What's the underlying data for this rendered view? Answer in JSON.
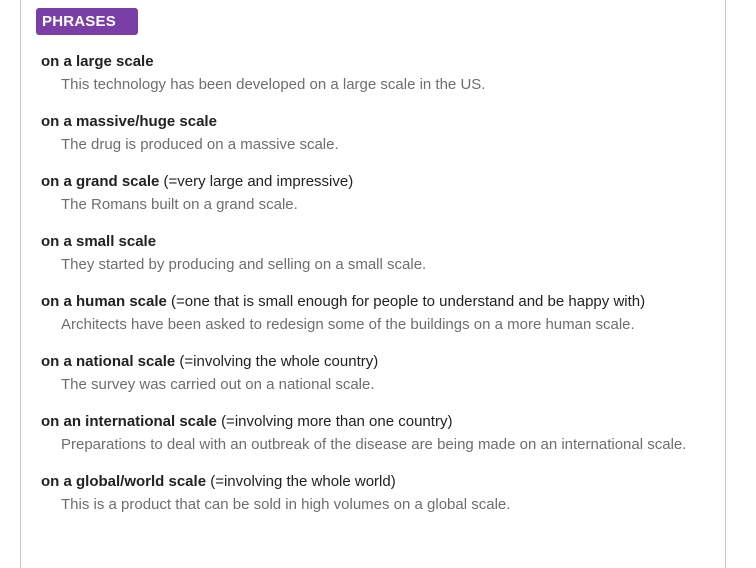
{
  "section": {
    "label": "PHRASES"
  },
  "phrases": [
    {
      "term": "on a large scale",
      "gloss": "",
      "example": "This technology has been developed on a large scale in the US."
    },
    {
      "term": "on a massive/huge scale",
      "gloss": "",
      "example": "The drug is produced on a massive scale."
    },
    {
      "term": "on a grand scale",
      "gloss": "(=very large and impressive)",
      "example": "The Romans built on a grand scale."
    },
    {
      "term": "on a small scale",
      "gloss": "",
      "example": "They started by producing and selling on a small scale."
    },
    {
      "term": "on a human scale",
      "gloss": "(=one that is small enough for people to understand and be happy with)",
      "example": "Architects have been asked to redesign some of the buildings on a more human scale."
    },
    {
      "term": "on a national scale",
      "gloss": "(=involving the whole country)",
      "example": "The survey was carried out on a national scale."
    },
    {
      "term": "on an international scale",
      "gloss": "(=involving more than one country)",
      "example": "Preparations to deal with an outbreak of the disease are being made on an international scale."
    },
    {
      "term": "on a global/world scale",
      "gloss": "(=involving the whole world)",
      "example": "This is a product that can be sold in high volumes on a global scale."
    }
  ]
}
